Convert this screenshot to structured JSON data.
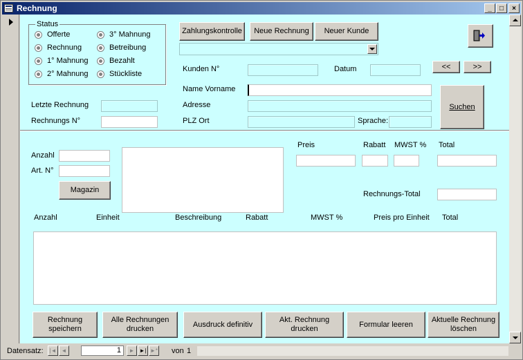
{
  "window": {
    "title": "Rechnung",
    "caption_buttons": {
      "minimize": "_",
      "maximize": "□",
      "close": "×"
    }
  },
  "status": {
    "label": "Status",
    "options": [
      "Offerte",
      "Rechnung",
      "1° Mahnung",
      "2° Mahnung",
      "3° Mahnung",
      "Betreibung",
      "Bezahlt",
      "Stückliste"
    ]
  },
  "toolbar": {
    "zahlungskontrolle": "Zahlungskontrolle",
    "neue_rechnung": "Neue Rechnung",
    "neuer_kunde": "Neuer Kunde",
    "prev": "<<",
    "next": ">>",
    "suchen": "Suchen"
  },
  "customer": {
    "kunden_nr": "Kunden N°",
    "datum": "Datum",
    "name_vorname": "Name Vorname",
    "adresse": "Adresse",
    "plz_ort": "PLZ Ort",
    "sprache": "Sprache:",
    "letzte_rechnung": "Letzte Rechnung",
    "rechnungs_nr": "Rechnungs N°"
  },
  "item_entry": {
    "anzahl": "Anzahl",
    "art_nr": "Art. N°",
    "magazin": "Magazin",
    "preis": "Preis",
    "rabatt": "Rabatt",
    "mwst": "MWST %",
    "total": "Total",
    "rechnungs_total": "Rechnungs-Total"
  },
  "table": {
    "columns": [
      "Anzahl",
      "Einheit",
      "Beschreibung",
      "Rabatt",
      "MWST %",
      "Preis pro Einheit",
      "Total"
    ]
  },
  "actions": {
    "speichern": "Rechnung speichern",
    "alle_drucken": "Alle Rechnungen drucken",
    "ausdruck": "Ausdruck definitiv",
    "akt_drucken": "Akt. Rechnung drucken",
    "formular_leeren": "Formular leeren",
    "aktuelle_loeschen": "Aktuelle Rechnung löschen"
  },
  "navigation": {
    "label": "Datensatz:",
    "current_record": "1",
    "of_label": "von",
    "total_records": "1",
    "first": "|◄",
    "prev": "◄",
    "next": "►",
    "last": "►|",
    "new": "►*"
  },
  "colors": {
    "form_background": "#ccffff",
    "title_bar": "#0a246a",
    "face": "#d4d0c8"
  }
}
